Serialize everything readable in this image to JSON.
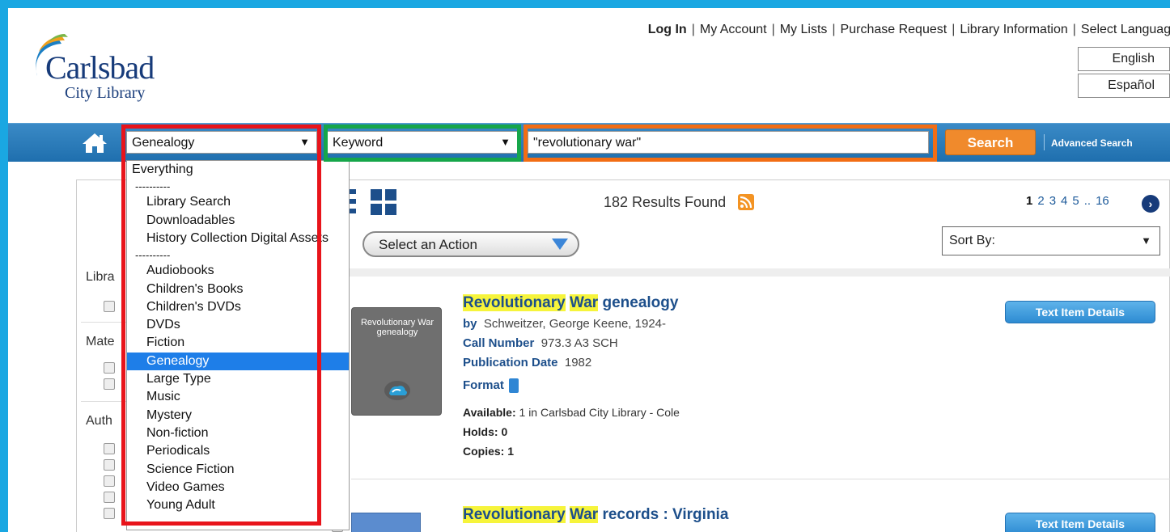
{
  "header": {
    "logo_main": "Carlsbad",
    "logo_sub": "City Library",
    "links": [
      "Log In",
      "My Account",
      "My Lists",
      "Purchase Request",
      "Library Information",
      "Select Language"
    ],
    "languages": [
      "English",
      "Español"
    ]
  },
  "navbar": {
    "home_icon": "home-icon",
    "collection_select": "Genealogy",
    "search_type_select": "Keyword",
    "search_query": "\"revolutionary war\"",
    "search_button": "Search",
    "advanced_search": "Advanced Search"
  },
  "dropdown": {
    "options": [
      {
        "label": "Everything",
        "type": "top"
      },
      {
        "label": "----------",
        "type": "sep"
      },
      {
        "label": "Library Search",
        "type": "item"
      },
      {
        "label": "Downloadables",
        "type": "item"
      },
      {
        "label": "History Collection Digital Assets",
        "type": "item"
      },
      {
        "label": "----------",
        "type": "sep"
      },
      {
        "label": "Audiobooks",
        "type": "item"
      },
      {
        "label": "Children's Books",
        "type": "item"
      },
      {
        "label": "Children's DVDs",
        "type": "item"
      },
      {
        "label": "DVDs",
        "type": "item"
      },
      {
        "label": "Fiction",
        "type": "item"
      },
      {
        "label": "Genealogy",
        "type": "selected"
      },
      {
        "label": "Large Type",
        "type": "item"
      },
      {
        "label": "Music",
        "type": "item"
      },
      {
        "label": "Mystery",
        "type": "item"
      },
      {
        "label": "Non-fiction",
        "type": "item"
      },
      {
        "label": "Periodicals",
        "type": "item"
      },
      {
        "label": "Science Fiction",
        "type": "item"
      },
      {
        "label": "Video Games",
        "type": "item"
      },
      {
        "label": "Young Adult",
        "type": "item"
      }
    ]
  },
  "sidebar": {
    "labels": [
      "Libra",
      "Mate",
      "Auth"
    ]
  },
  "results": {
    "count_text": "182 Results Found",
    "pages": [
      "1",
      "2",
      "3",
      "4",
      "5",
      "..",
      "16"
    ],
    "action_select": "Select an Action",
    "sort_select": "Sort By:",
    "items": [
      {
        "title_hl1": "Revolutionary",
        "title_hl2": "War",
        "title_rest": "genealogy",
        "cover_text": "Revolutionary War genealogy",
        "by_label": "by",
        "author": "Schweitzer, George Keene, 1924-",
        "call_label": "Call Number",
        "call_number": "973.3 A3 SCH",
        "pub_label": "Publication Date",
        "pub_date": "1982",
        "format_label": "Format",
        "available_label": "Available:",
        "available": "1 in Carlsbad City Library - Cole",
        "holds_label": "Holds:",
        "holds": "0",
        "copies_label": "Copies:",
        "copies": "1",
        "details_button": "Text Item Details"
      },
      {
        "title_hl1": "Revolutionary",
        "title_hl2": "War",
        "title_rest": "records : Virginia",
        "details_button": "Text Item Details"
      }
    ]
  },
  "colors": {
    "frame": "#1aa7e2",
    "navbar": "#1f6fae",
    "search_button": "#f08a2c",
    "highlight_red": "#e8141b",
    "highlight_green": "#16a64a",
    "highlight_orange": "#f26d14",
    "selected_option": "#1e7ee8",
    "keyword_highlight": "#f6f43b"
  }
}
